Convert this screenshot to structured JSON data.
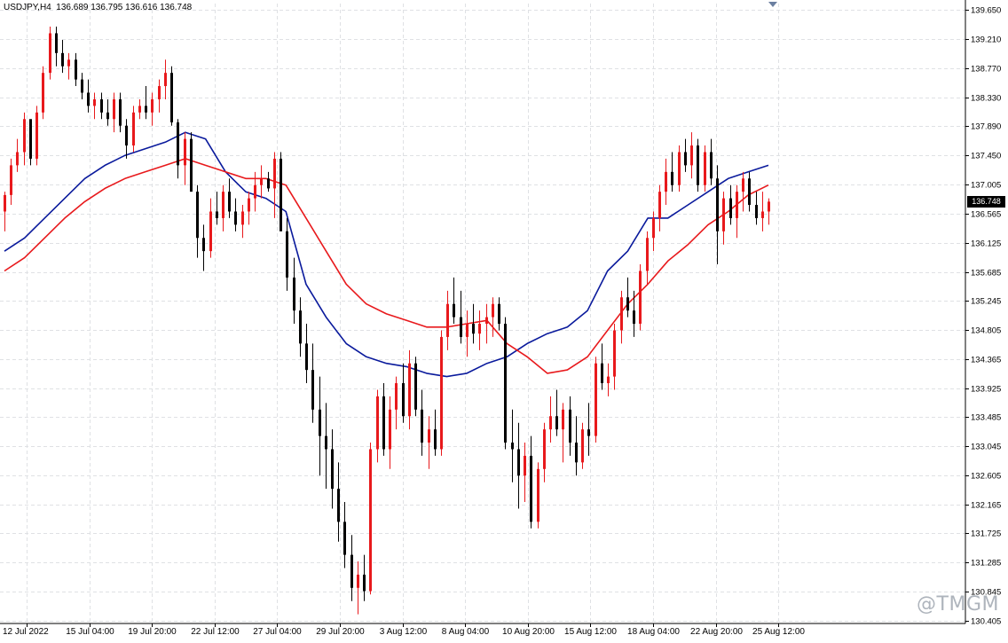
{
  "header": {
    "symbol": "USDJPY,H4",
    "ohlc": "136.689 136.795 136.616 136.748"
  },
  "watermark": "@TMGM",
  "current_price_label": "136.748",
  "colors": {
    "bull_candle": "#e8191c",
    "bear_candle": "#000000",
    "ma_fast": "#0a1a9c",
    "ma_slow": "#e8191c",
    "grid": "#dfe1e4",
    "background": "#ffffff"
  },
  "chart_data": {
    "type": "candlestick",
    "symbol": "USDJPY",
    "timeframe": "H4",
    "y_range": [
      130.36,
      139.75
    ],
    "y_ticks": [
      "139.650",
      "139.210",
      "138.770",
      "138.330",
      "137.890",
      "137.450",
      "137.005",
      "136.565",
      "136.125",
      "135.685",
      "135.245",
      "134.805",
      "134.365",
      "133.925",
      "133.485",
      "133.045",
      "132.605",
      "132.165",
      "131.725",
      "131.285",
      "130.845",
      "130.405"
    ],
    "x_ticks": [
      "12 Jul 2022",
      "15 Jul 04:00",
      "19 Jul 20:00",
      "22 Jul 12:00",
      "27 Jul 04:00",
      "29 Jul 20:00",
      "3 Aug 12:00",
      "8 Aug 04:00",
      "10 Aug 20:00",
      "15 Aug 12:00",
      "18 Aug 04:00",
      "22 Aug 20:00",
      "25 Aug 12:00"
    ],
    "candles": [
      [
        136.6,
        136.9,
        136.3,
        136.85
      ],
      [
        136.85,
        137.4,
        136.7,
        137.3
      ],
      [
        137.3,
        137.7,
        137.2,
        137.5
      ],
      [
        137.5,
        138.1,
        137.3,
        138.0
      ],
      [
        138.0,
        137.9,
        137.3,
        137.4
      ],
      [
        137.4,
        138.2,
        137.3,
        138.1
      ],
      [
        138.1,
        138.8,
        138.0,
        138.7
      ],
      [
        138.7,
        139.4,
        138.6,
        139.3
      ],
      [
        139.3,
        139.4,
        138.8,
        139.0
      ],
      [
        139.0,
        139.2,
        138.7,
        138.8
      ],
      [
        138.8,
        139.0,
        138.6,
        138.9
      ],
      [
        138.9,
        139.0,
        138.5,
        138.6
      ],
      [
        138.6,
        138.7,
        138.3,
        138.4
      ],
      [
        138.4,
        138.6,
        138.1,
        138.2
      ],
      [
        138.2,
        138.4,
        138.0,
        138.3
      ],
      [
        138.3,
        138.4,
        138.0,
        138.1
      ],
      [
        138.1,
        138.3,
        137.9,
        138.0
      ],
      [
        138.0,
        138.4,
        137.8,
        138.3
      ],
      [
        138.3,
        138.4,
        137.8,
        137.9
      ],
      [
        137.9,
        138.0,
        137.4,
        137.6
      ],
      [
        137.6,
        138.2,
        137.5,
        138.1
      ],
      [
        138.1,
        138.3,
        138.0,
        138.2
      ],
      [
        138.2,
        138.5,
        138.0,
        138.1
      ],
      [
        138.1,
        138.4,
        137.9,
        138.3
      ],
      [
        138.3,
        138.6,
        138.1,
        138.5
      ],
      [
        138.5,
        138.9,
        138.3,
        138.7
      ],
      [
        138.7,
        138.8,
        137.9,
        137.95
      ],
      [
        137.95,
        138.0,
        137.1,
        137.3
      ],
      [
        137.3,
        137.8,
        137.0,
        137.7
      ],
      [
        137.7,
        137.8,
        137.0,
        136.9
      ],
      [
        136.9,
        137.0,
        135.9,
        136.2
      ],
      [
        136.2,
        136.4,
        135.7,
        136.0
      ],
      [
        136.0,
        136.8,
        135.9,
        136.6
      ],
      [
        136.6,
        136.9,
        136.4,
        136.5
      ],
      [
        136.5,
        137.0,
        136.3,
        136.9
      ],
      [
        136.9,
        137.1,
        136.5,
        136.6
      ],
      [
        136.6,
        136.8,
        136.3,
        136.4
      ],
      [
        136.4,
        136.7,
        136.2,
        136.6
      ],
      [
        136.6,
        136.9,
        136.4,
        136.8
      ],
      [
        136.8,
        137.2,
        136.6,
        137.0
      ],
      [
        137.0,
        137.3,
        136.8,
        137.1
      ],
      [
        137.1,
        137.2,
        136.9,
        136.95
      ],
      [
        136.95,
        137.5,
        136.5,
        137.4
      ],
      [
        137.4,
        137.5,
        136.7,
        136.3
      ],
      [
        136.3,
        136.5,
        135.4,
        135.6
      ],
      [
        135.6,
        135.9,
        134.9,
        135.1
      ],
      [
        135.1,
        135.3,
        134.4,
        134.6
      ],
      [
        134.6,
        134.9,
        134.0,
        134.2
      ],
      [
        134.2,
        134.6,
        133.4,
        133.6
      ],
      [
        133.6,
        134.1,
        132.6,
        133.2
      ],
      [
        133.2,
        133.7,
        132.4,
        133.0
      ],
      [
        133.0,
        133.3,
        132.1,
        132.4
      ],
      [
        132.4,
        132.8,
        131.6,
        131.9
      ],
      [
        131.9,
        132.2,
        131.2,
        131.4
      ],
      [
        131.4,
        131.7,
        130.7,
        130.9
      ],
      [
        130.9,
        131.3,
        130.5,
        131.1
      ],
      [
        131.1,
        131.4,
        130.7,
        130.85
      ],
      [
        130.85,
        133.1,
        130.8,
        133.0
      ],
      [
        133.0,
        133.9,
        132.8,
        133.8
      ],
      [
        133.8,
        134.0,
        132.9,
        133.0
      ],
      [
        133.0,
        133.8,
        132.7,
        133.6
      ],
      [
        133.6,
        134.1,
        133.3,
        134.0
      ],
      [
        134.0,
        134.3,
        133.4,
        133.5
      ],
      [
        133.5,
        134.5,
        133.3,
        134.3
      ],
      [
        134.3,
        134.4,
        133.5,
        133.6
      ],
      [
        133.6,
        133.9,
        132.9,
        133.1
      ],
      [
        133.1,
        133.5,
        132.7,
        133.3
      ],
      [
        133.3,
        133.6,
        132.9,
        133.0
      ],
      [
        133.0,
        134.8,
        132.9,
        134.7
      ],
      [
        134.7,
        135.4,
        134.5,
        135.2
      ],
      [
        135.2,
        135.6,
        134.9,
        135.0
      ],
      [
        135.0,
        135.4,
        134.6,
        134.7
      ],
      [
        134.7,
        135.1,
        134.4,
        134.9
      ],
      [
        134.9,
        135.2,
        134.6,
        134.75
      ],
      [
        134.75,
        135.1,
        134.5,
        134.9
      ],
      [
        134.9,
        135.2,
        134.6,
        135.0
      ],
      [
        135.0,
        135.3,
        134.7,
        135.2
      ],
      [
        135.2,
        135.3,
        134.8,
        134.9
      ],
      [
        134.9,
        135.0,
        133.0,
        133.1
      ],
      [
        133.1,
        133.6,
        132.5,
        133.0
      ],
      [
        133.0,
        133.4,
        132.1,
        132.6
      ],
      [
        132.6,
        133.1,
        132.2,
        132.9
      ],
      [
        132.9,
        133.2,
        131.8,
        131.9
      ],
      [
        131.9,
        132.8,
        131.8,
        132.7
      ],
      [
        132.7,
        133.4,
        132.5,
        133.3
      ],
      [
        133.3,
        133.8,
        133.1,
        133.5
      ],
      [
        133.5,
        133.9,
        133.2,
        133.3
      ],
      [
        133.3,
        133.7,
        132.8,
        133.6
      ],
      [
        133.6,
        133.8,
        132.9,
        133.1
      ],
      [
        133.1,
        133.5,
        132.6,
        132.8
      ],
      [
        132.8,
        133.4,
        132.7,
        133.3
      ],
      [
        133.3,
        133.7,
        132.9,
        133.2
      ],
      [
        133.2,
        134.4,
        133.1,
        134.3
      ],
      [
        134.3,
        134.6,
        133.9,
        134.0
      ],
      [
        134.0,
        134.3,
        133.8,
        134.1
      ],
      [
        134.1,
        134.9,
        133.9,
        134.8
      ],
      [
        134.8,
        135.4,
        134.6,
        135.3
      ],
      [
        135.3,
        135.6,
        135.0,
        135.1
      ],
      [
        135.1,
        135.4,
        134.7,
        134.9
      ],
      [
        134.9,
        135.8,
        134.8,
        135.7
      ],
      [
        135.7,
        136.3,
        135.5,
        136.2
      ],
      [
        136.2,
        136.6,
        136.0,
        136.5
      ],
      [
        136.5,
        137.0,
        136.3,
        136.9
      ],
      [
        136.9,
        137.4,
        136.7,
        137.2
      ],
      [
        137.2,
        137.5,
        136.9,
        137.0
      ],
      [
        137.0,
        137.6,
        136.9,
        137.5
      ],
      [
        137.5,
        137.7,
        137.2,
        137.3
      ],
      [
        137.3,
        137.8,
        137.1,
        137.6
      ],
      [
        137.6,
        137.7,
        136.9,
        137.0
      ],
      [
        137.0,
        137.6,
        136.9,
        137.5
      ],
      [
        137.5,
        137.7,
        137.0,
        137.1
      ],
      [
        137.1,
        137.3,
        135.8,
        136.3
      ],
      [
        136.3,
        136.9,
        136.1,
        136.8
      ],
      [
        136.8,
        137.0,
        136.4,
        136.5
      ],
      [
        136.5,
        137.0,
        136.2,
        136.9
      ],
      [
        136.9,
        137.2,
        136.6,
        137.1
      ],
      [
        137.1,
        137.2,
        136.6,
        136.7
      ],
      [
        136.7,
        136.9,
        136.4,
        136.5
      ],
      [
        136.5,
        136.9,
        136.3,
        136.6
      ],
      [
        136.6,
        136.8,
        136.4,
        136.75
      ]
    ],
    "series": [
      {
        "type": "moving-average",
        "color": "#0a1a9c",
        "values": [
          136.0,
          136.2,
          136.5,
          136.8,
          137.1,
          137.3,
          137.45,
          137.55,
          137.65,
          137.8,
          137.7,
          137.2,
          136.9,
          136.8,
          136.6,
          135.5,
          135.0,
          134.6,
          134.4,
          134.3,
          134.25,
          134.15,
          134.1,
          134.15,
          134.3,
          134.4,
          134.6,
          134.75,
          134.85,
          135.1,
          135.7,
          136.0,
          136.5,
          136.5,
          136.7,
          136.9,
          137.1,
          137.2,
          137.3
        ]
      },
      {
        "type": "moving-average",
        "color": "#e8191c",
        "values": [
          135.7,
          135.9,
          136.2,
          136.5,
          136.75,
          136.95,
          137.1,
          137.2,
          137.3,
          137.4,
          137.3,
          137.2,
          137.1,
          137.1,
          137.0,
          136.5,
          136.0,
          135.5,
          135.2,
          135.05,
          134.95,
          134.85,
          134.85,
          134.9,
          134.95,
          134.6,
          134.4,
          134.15,
          134.2,
          134.4,
          134.8,
          135.2,
          135.5,
          135.85,
          136.1,
          136.4,
          136.6,
          136.85,
          137.0
        ]
      }
    ]
  }
}
